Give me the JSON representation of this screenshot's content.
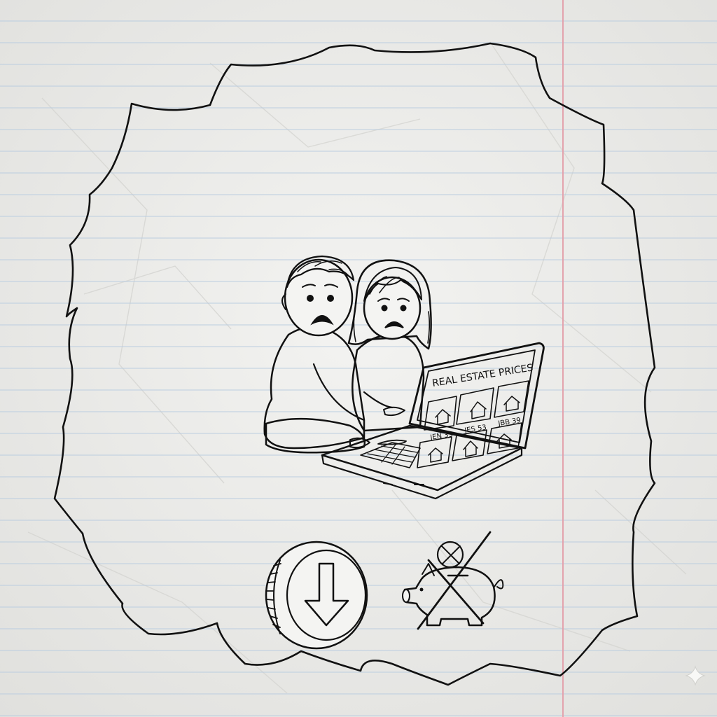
{
  "colors": {
    "paper": "#eeeeec",
    "rule_line": "#b9cce0",
    "margin_line": "#e3a3ad",
    "ink": "#111111"
  },
  "laptop_screen": {
    "title": "REAL ESTATE PRICES",
    "listing_prices": [
      "JEN 33",
      "JES 53",
      "JBB 39"
    ]
  },
  "icons": [
    "frowning-couple",
    "laptop-icon",
    "house-icon",
    "coin-down-arrow-icon",
    "crossed-out-piggy-bank-icon"
  ]
}
